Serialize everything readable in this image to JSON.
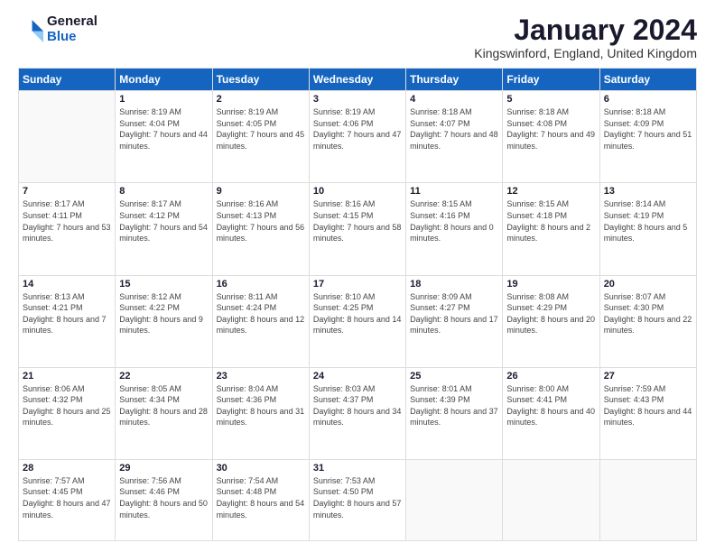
{
  "logo": {
    "general": "General",
    "blue": "Blue"
  },
  "header": {
    "month": "January 2024",
    "location": "Kingswinford, England, United Kingdom"
  },
  "weekdays": [
    "Sunday",
    "Monday",
    "Tuesday",
    "Wednesday",
    "Thursday",
    "Friday",
    "Saturday"
  ],
  "weeks": [
    [
      {
        "day": "",
        "sunrise": "",
        "sunset": "",
        "daylight": ""
      },
      {
        "day": "1",
        "sunrise": "Sunrise: 8:19 AM",
        "sunset": "Sunset: 4:04 PM",
        "daylight": "Daylight: 7 hours and 44 minutes."
      },
      {
        "day": "2",
        "sunrise": "Sunrise: 8:19 AM",
        "sunset": "Sunset: 4:05 PM",
        "daylight": "Daylight: 7 hours and 45 minutes."
      },
      {
        "day": "3",
        "sunrise": "Sunrise: 8:19 AM",
        "sunset": "Sunset: 4:06 PM",
        "daylight": "Daylight: 7 hours and 47 minutes."
      },
      {
        "day": "4",
        "sunrise": "Sunrise: 8:18 AM",
        "sunset": "Sunset: 4:07 PM",
        "daylight": "Daylight: 7 hours and 48 minutes."
      },
      {
        "day": "5",
        "sunrise": "Sunrise: 8:18 AM",
        "sunset": "Sunset: 4:08 PM",
        "daylight": "Daylight: 7 hours and 49 minutes."
      },
      {
        "day": "6",
        "sunrise": "Sunrise: 8:18 AM",
        "sunset": "Sunset: 4:09 PM",
        "daylight": "Daylight: 7 hours and 51 minutes."
      }
    ],
    [
      {
        "day": "7",
        "sunrise": "Sunrise: 8:17 AM",
        "sunset": "Sunset: 4:11 PM",
        "daylight": "Daylight: 7 hours and 53 minutes."
      },
      {
        "day": "8",
        "sunrise": "Sunrise: 8:17 AM",
        "sunset": "Sunset: 4:12 PM",
        "daylight": "Daylight: 7 hours and 54 minutes."
      },
      {
        "day": "9",
        "sunrise": "Sunrise: 8:16 AM",
        "sunset": "Sunset: 4:13 PM",
        "daylight": "Daylight: 7 hours and 56 minutes."
      },
      {
        "day": "10",
        "sunrise": "Sunrise: 8:16 AM",
        "sunset": "Sunset: 4:15 PM",
        "daylight": "Daylight: 7 hours and 58 minutes."
      },
      {
        "day": "11",
        "sunrise": "Sunrise: 8:15 AM",
        "sunset": "Sunset: 4:16 PM",
        "daylight": "Daylight: 8 hours and 0 minutes."
      },
      {
        "day": "12",
        "sunrise": "Sunrise: 8:15 AM",
        "sunset": "Sunset: 4:18 PM",
        "daylight": "Daylight: 8 hours and 2 minutes."
      },
      {
        "day": "13",
        "sunrise": "Sunrise: 8:14 AM",
        "sunset": "Sunset: 4:19 PM",
        "daylight": "Daylight: 8 hours and 5 minutes."
      }
    ],
    [
      {
        "day": "14",
        "sunrise": "Sunrise: 8:13 AM",
        "sunset": "Sunset: 4:21 PM",
        "daylight": "Daylight: 8 hours and 7 minutes."
      },
      {
        "day": "15",
        "sunrise": "Sunrise: 8:12 AM",
        "sunset": "Sunset: 4:22 PM",
        "daylight": "Daylight: 8 hours and 9 minutes."
      },
      {
        "day": "16",
        "sunrise": "Sunrise: 8:11 AM",
        "sunset": "Sunset: 4:24 PM",
        "daylight": "Daylight: 8 hours and 12 minutes."
      },
      {
        "day": "17",
        "sunrise": "Sunrise: 8:10 AM",
        "sunset": "Sunset: 4:25 PM",
        "daylight": "Daylight: 8 hours and 14 minutes."
      },
      {
        "day": "18",
        "sunrise": "Sunrise: 8:09 AM",
        "sunset": "Sunset: 4:27 PM",
        "daylight": "Daylight: 8 hours and 17 minutes."
      },
      {
        "day": "19",
        "sunrise": "Sunrise: 8:08 AM",
        "sunset": "Sunset: 4:29 PM",
        "daylight": "Daylight: 8 hours and 20 minutes."
      },
      {
        "day": "20",
        "sunrise": "Sunrise: 8:07 AM",
        "sunset": "Sunset: 4:30 PM",
        "daylight": "Daylight: 8 hours and 22 minutes."
      }
    ],
    [
      {
        "day": "21",
        "sunrise": "Sunrise: 8:06 AM",
        "sunset": "Sunset: 4:32 PM",
        "daylight": "Daylight: 8 hours and 25 minutes."
      },
      {
        "day": "22",
        "sunrise": "Sunrise: 8:05 AM",
        "sunset": "Sunset: 4:34 PM",
        "daylight": "Daylight: 8 hours and 28 minutes."
      },
      {
        "day": "23",
        "sunrise": "Sunrise: 8:04 AM",
        "sunset": "Sunset: 4:36 PM",
        "daylight": "Daylight: 8 hours and 31 minutes."
      },
      {
        "day": "24",
        "sunrise": "Sunrise: 8:03 AM",
        "sunset": "Sunset: 4:37 PM",
        "daylight": "Daylight: 8 hours and 34 minutes."
      },
      {
        "day": "25",
        "sunrise": "Sunrise: 8:01 AM",
        "sunset": "Sunset: 4:39 PM",
        "daylight": "Daylight: 8 hours and 37 minutes."
      },
      {
        "day": "26",
        "sunrise": "Sunrise: 8:00 AM",
        "sunset": "Sunset: 4:41 PM",
        "daylight": "Daylight: 8 hours and 40 minutes."
      },
      {
        "day": "27",
        "sunrise": "Sunrise: 7:59 AM",
        "sunset": "Sunset: 4:43 PM",
        "daylight": "Daylight: 8 hours and 44 minutes."
      }
    ],
    [
      {
        "day": "28",
        "sunrise": "Sunrise: 7:57 AM",
        "sunset": "Sunset: 4:45 PM",
        "daylight": "Daylight: 8 hours and 47 minutes."
      },
      {
        "day": "29",
        "sunrise": "Sunrise: 7:56 AM",
        "sunset": "Sunset: 4:46 PM",
        "daylight": "Daylight: 8 hours and 50 minutes."
      },
      {
        "day": "30",
        "sunrise": "Sunrise: 7:54 AM",
        "sunset": "Sunset: 4:48 PM",
        "daylight": "Daylight: 8 hours and 54 minutes."
      },
      {
        "day": "31",
        "sunrise": "Sunrise: 7:53 AM",
        "sunset": "Sunset: 4:50 PM",
        "daylight": "Daylight: 8 hours and 57 minutes."
      },
      {
        "day": "",
        "sunrise": "",
        "sunset": "",
        "daylight": ""
      },
      {
        "day": "",
        "sunrise": "",
        "sunset": "",
        "daylight": ""
      },
      {
        "day": "",
        "sunrise": "",
        "sunset": "",
        "daylight": ""
      }
    ]
  ]
}
